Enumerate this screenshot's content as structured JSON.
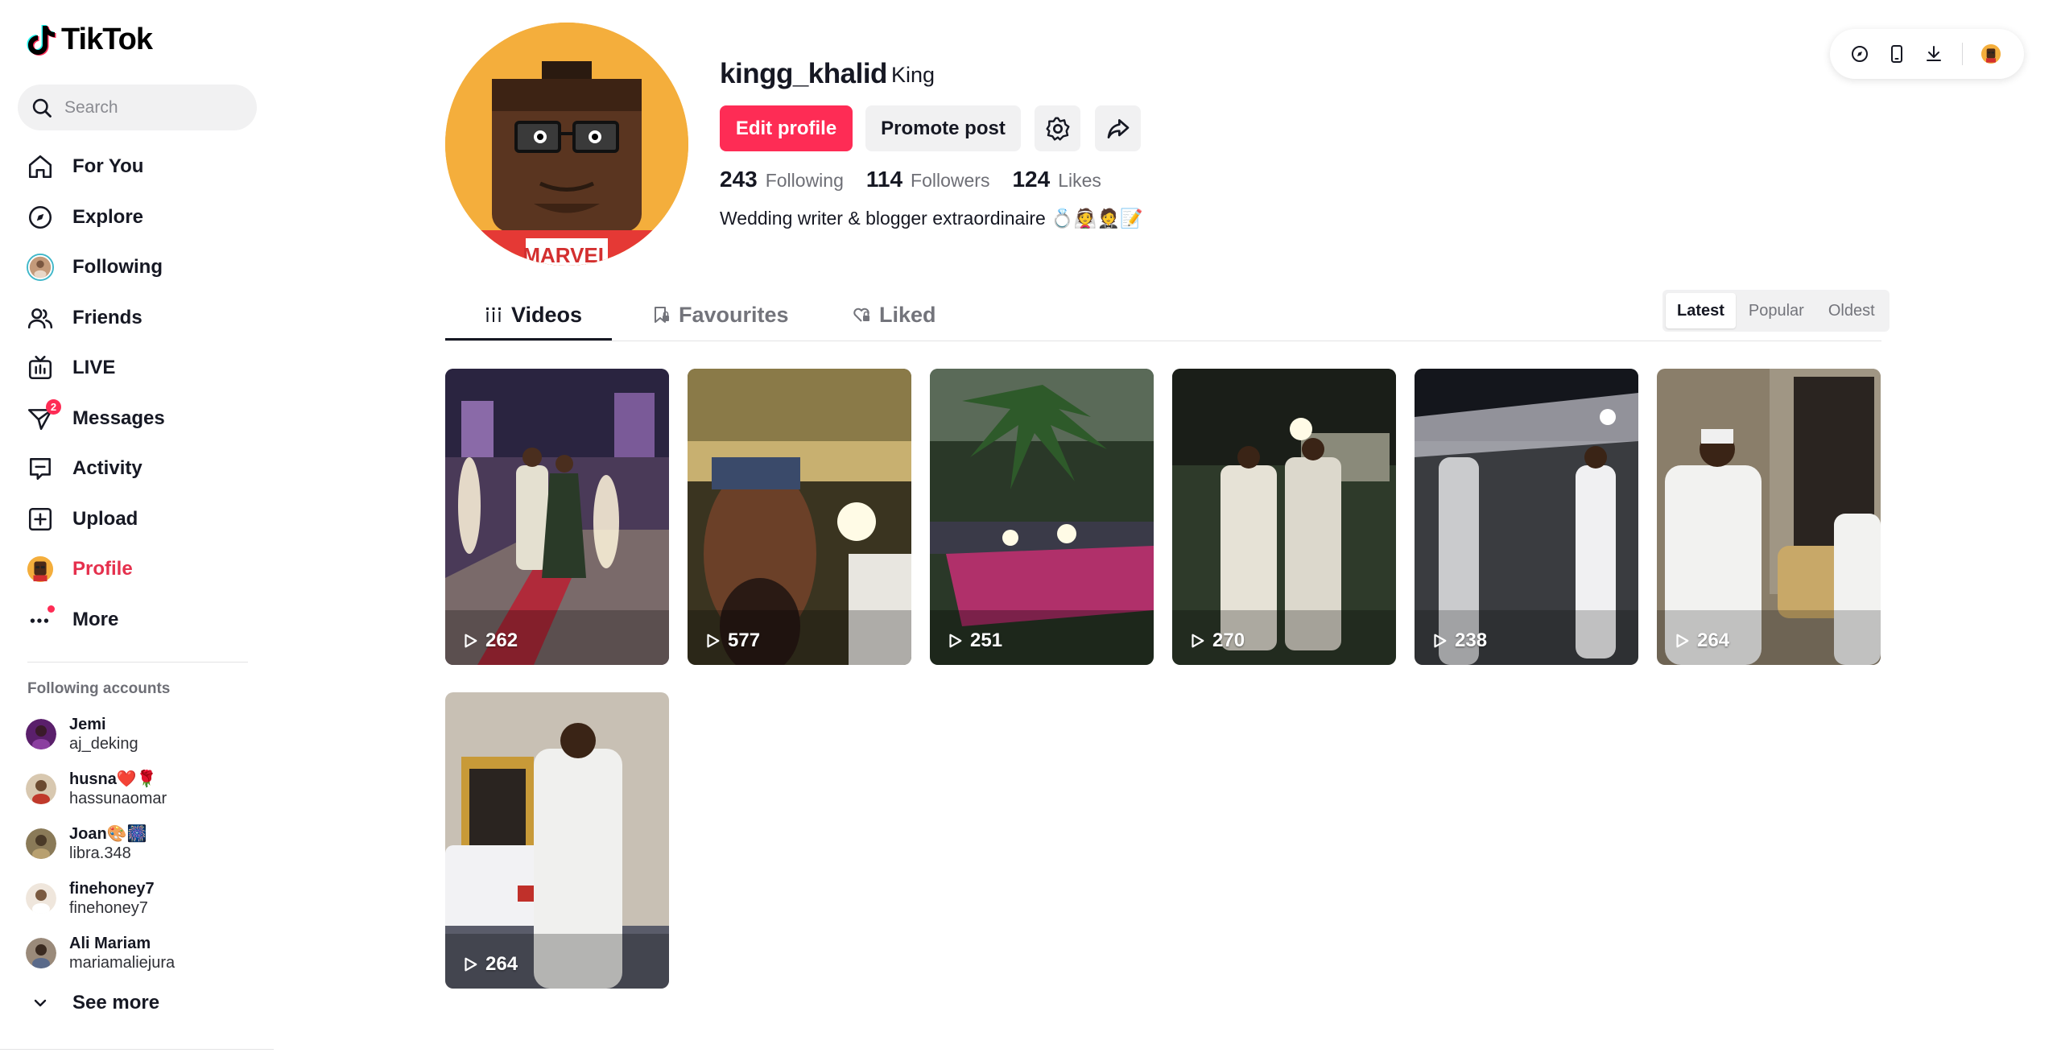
{
  "app": {
    "logo_text": "TikTok"
  },
  "search": {
    "placeholder": "Search"
  },
  "nav": {
    "items": [
      {
        "label": "For You"
      },
      {
        "label": "Explore"
      },
      {
        "label": "Following"
      },
      {
        "label": "Friends"
      },
      {
        "label": "LIVE"
      },
      {
        "label": "Messages",
        "badge": "2"
      },
      {
        "label": "Activity"
      },
      {
        "label": "Upload"
      },
      {
        "label": "Profile"
      },
      {
        "label": "More"
      }
    ]
  },
  "following_accounts": {
    "title": "Following accounts",
    "accounts": [
      {
        "name": "Jemi",
        "username": "aj_deking"
      },
      {
        "name": "husna❤️🌹",
        "username": "hassunaomar"
      },
      {
        "name": "Joan🎨🎆",
        "username": "libra.348"
      },
      {
        "name": "finehoney7",
        "username": "finehoney7"
      },
      {
        "name": "Ali Mariam",
        "username": "mariamaliejura"
      }
    ],
    "see_more": "See more"
  },
  "profile": {
    "username": "kingg_khalid",
    "nickname": "King",
    "edit_label": "Edit profile",
    "promote_label": "Promote post",
    "stats": [
      {
        "value": "243",
        "label": "Following"
      },
      {
        "value": "114",
        "label": "Followers"
      },
      {
        "value": "124",
        "label": "Likes"
      }
    ],
    "bio": "Wedding writer & blogger extraordinaire 💍👰🤵📝",
    "avatar_text": "MARVEL"
  },
  "tabs": [
    {
      "label": "Videos"
    },
    {
      "label": "Favourites"
    },
    {
      "label": "Liked"
    }
  ],
  "sort": {
    "options": [
      "Latest",
      "Popular",
      "Oldest"
    ],
    "selected": "Latest"
  },
  "videos": [
    {
      "views": "262"
    },
    {
      "views": "577"
    },
    {
      "views": "251"
    },
    {
      "views": "270"
    },
    {
      "views": "238"
    },
    {
      "views": "264"
    },
    {
      "views": "264"
    }
  ],
  "colors": {
    "accent": "#fe2c55",
    "active_text": "#e5304d"
  }
}
